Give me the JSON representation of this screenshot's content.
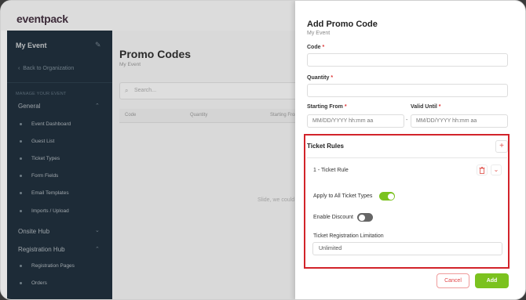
{
  "app": {
    "logo_text": "eventpack"
  },
  "sidebar": {
    "event_name": "My Event",
    "back_link": "Back to Organization",
    "section_label": "MANAGE YOUR EVENT",
    "groups": [
      {
        "label": "General",
        "items": [
          "Event Dashboard",
          "Guest List",
          "Ticket Types",
          "Form Fields",
          "Email Templates",
          "Imports / Upload"
        ]
      },
      {
        "label": "Onsite Hub",
        "items": []
      },
      {
        "label": "Registration Hub",
        "items": [
          "Registration Pages",
          "Orders"
        ]
      }
    ]
  },
  "main": {
    "title": "Promo Codes",
    "subtitle": "My Event",
    "search_placeholder": "Search...",
    "columns": [
      "Code",
      "Quantity",
      "Starting From"
    ],
    "empty_text": "Slide, we could"
  },
  "drawer": {
    "title": "Add Promo Code",
    "subtitle": "My Event",
    "fields": {
      "code_label": "Code",
      "quantity_label": "Quantity",
      "starting_from_label": "Starting From",
      "valid_until_label": "Valid Until",
      "date_placeholder": "MM/DD/YYYY hh:mm aa",
      "required_mark": "*",
      "date_separator": "-"
    },
    "ticket_rules": {
      "title": "Ticket Rules",
      "add_symbol": "+",
      "rule_name": "1 - Ticket Rule",
      "apply_all_label": "Apply to All Ticket Types",
      "apply_all_on": true,
      "enable_discount_label": "Enable Discount",
      "enable_discount_on": false,
      "limitation_label": "Ticket Registration Limitation",
      "limitation_value": "Unlimited"
    },
    "buttons": {
      "cancel": "Cancel",
      "add": "Add"
    }
  },
  "colors": {
    "accent_green": "#7bc21f",
    "danger": "#e2474a",
    "highlight_border": "#d2232a",
    "sidebar_bg": "#253746"
  }
}
